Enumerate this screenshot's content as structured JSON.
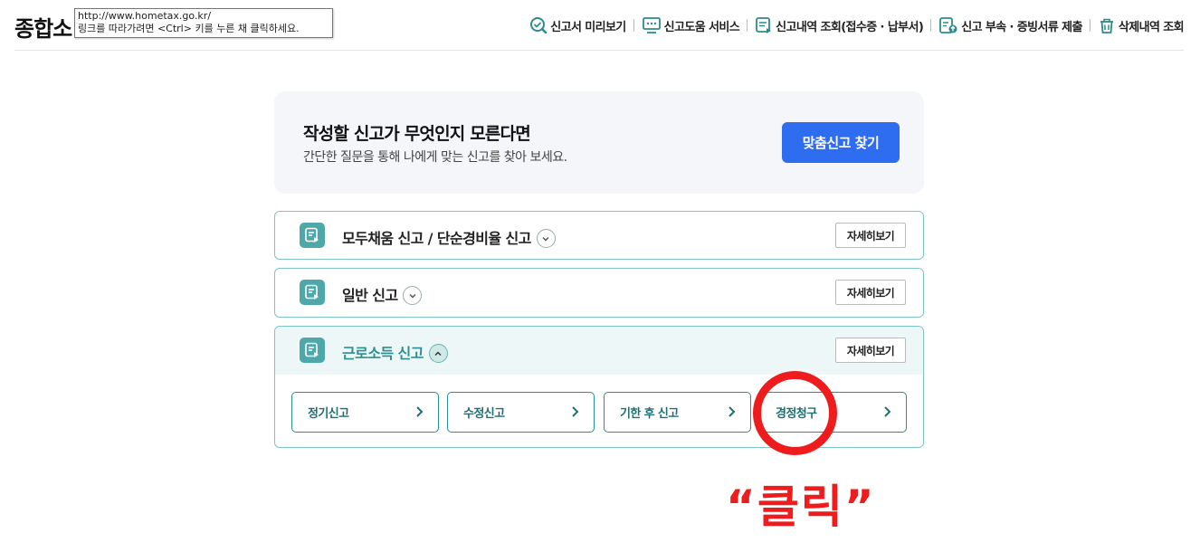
{
  "header": {
    "title": "종합소",
    "tooltip": {
      "url": "http://www.hometax.go.kr/",
      "hint": "링크를 따라가려면 <Ctrl> 키를 누른 채 클릭하세요."
    },
    "nav": [
      {
        "label": "신고서 미리보기",
        "icon": "search-icon"
      },
      {
        "label": "신고도움 서비스",
        "icon": "monitor-help-icon"
      },
      {
        "label": "신고내역 조회(접수증 · 납부서)",
        "icon": "document-list-icon"
      },
      {
        "label": "신고 부속 · 증빙서류 제출",
        "icon": "document-upload-icon"
      },
      {
        "label": "삭제내역 조회",
        "icon": "trash-icon"
      }
    ]
  },
  "finder": {
    "title": "작성할 신고가 무엇인지 모른다면",
    "desc": "간단한 질문을 통해 나에게 맞는 신고를 찾아 보세요.",
    "button": "맞춤신고 찾기"
  },
  "cards": [
    {
      "title": "모두채움 신고 / 단순경비율 신고",
      "detail": "자세히보기",
      "expanded": false
    },
    {
      "title": "일반 신고",
      "detail": "자세히보기",
      "expanded": false
    },
    {
      "title": "근로소득 신고",
      "detail": "자세히보기",
      "expanded": true,
      "sub_items": [
        "정기신고",
        "수정신고",
        "기한 후 신고",
        "경정청구"
      ]
    }
  ],
  "annotation": {
    "label": "“클릭”",
    "color": "#ee1c1c"
  },
  "colors": {
    "accent_teal": "#2b8d8f",
    "primary_blue": "#2e6cf0",
    "card_border": "#7fc4c4"
  }
}
